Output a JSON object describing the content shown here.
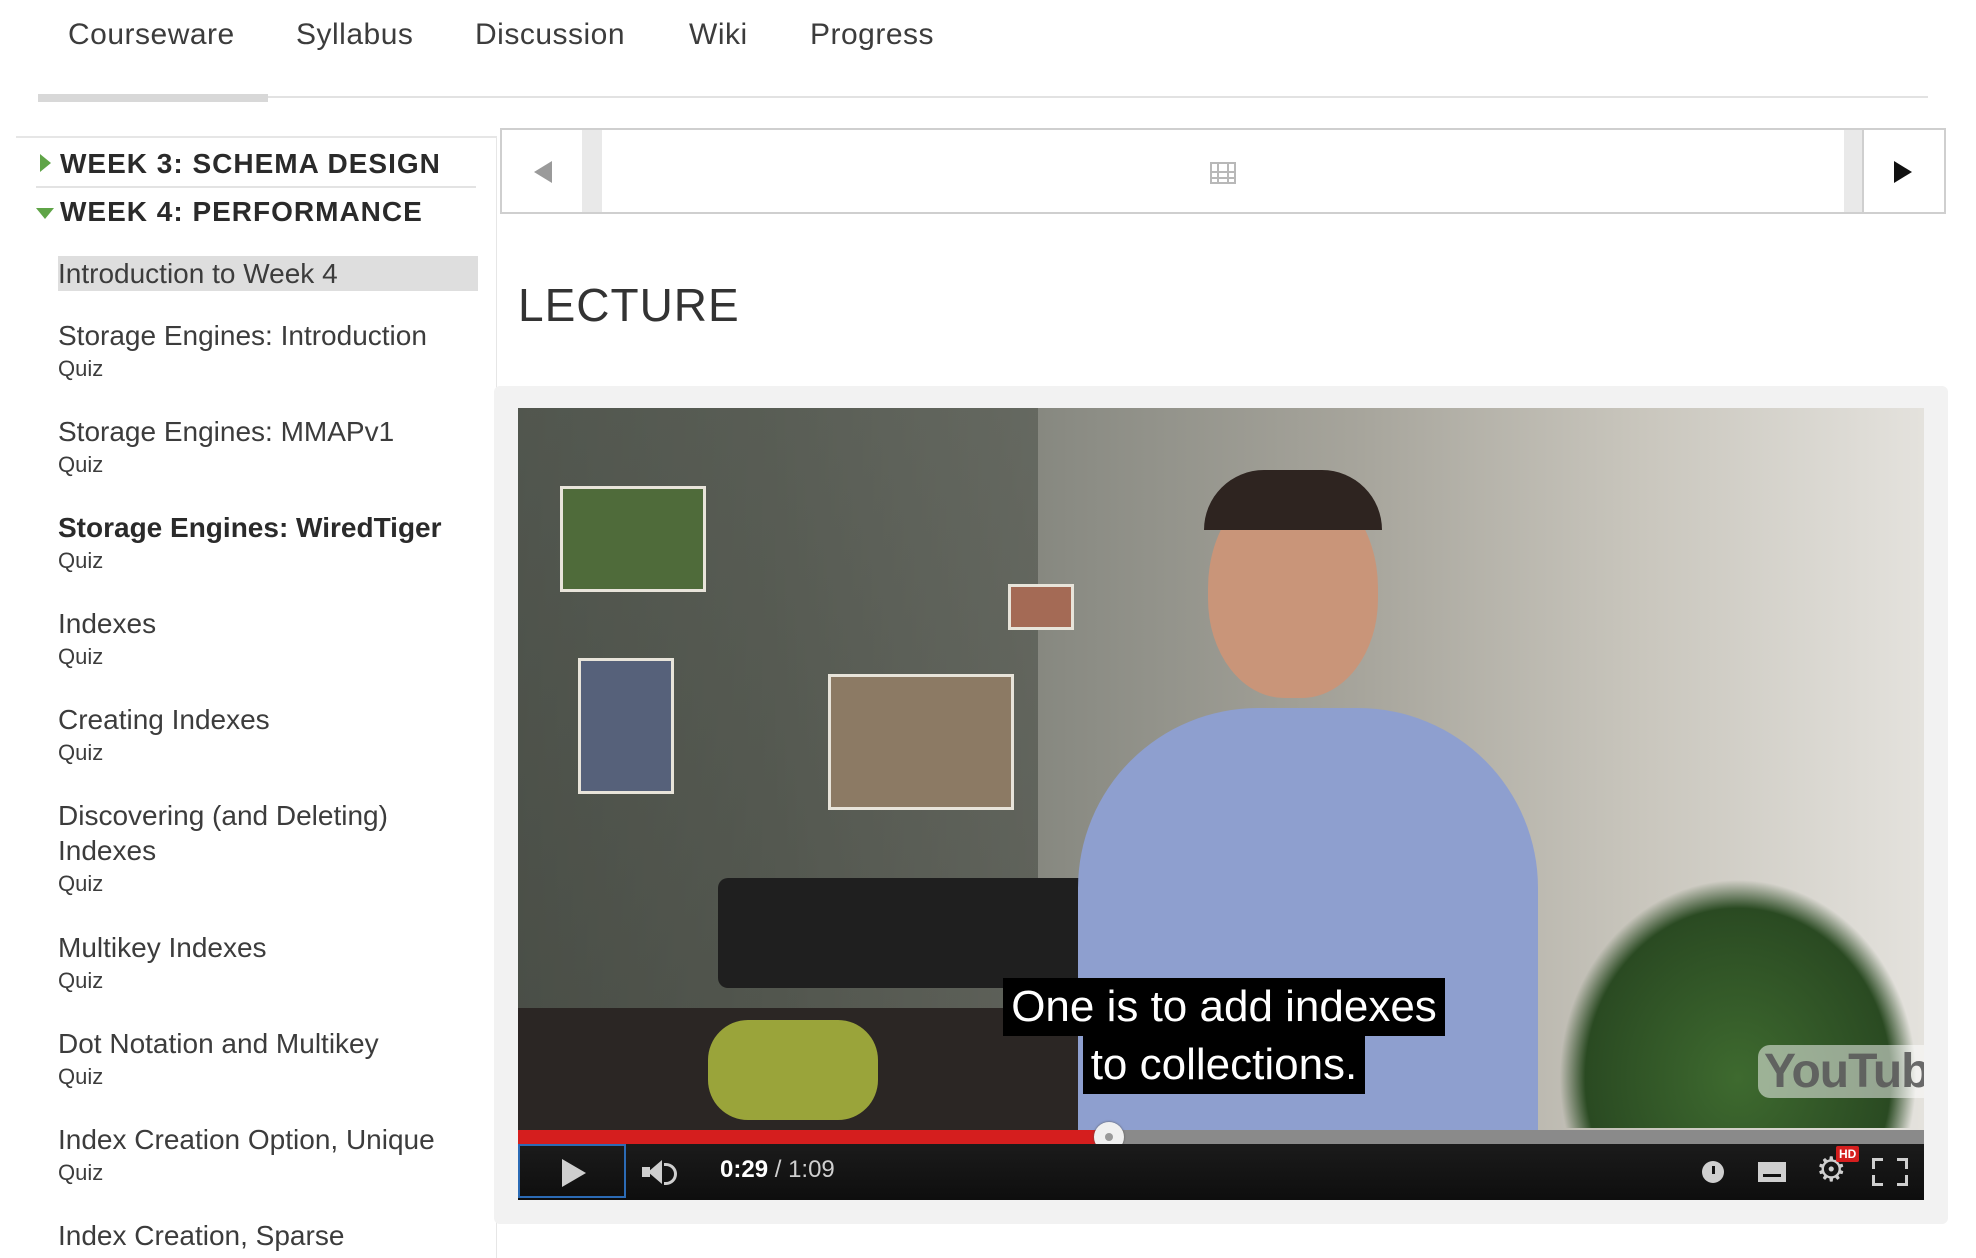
{
  "tabs": [
    {
      "label": "Courseware"
    },
    {
      "label": "Syllabus"
    },
    {
      "label": "Discussion"
    },
    {
      "label": "Wiki"
    },
    {
      "label": "Progress"
    }
  ],
  "sidebar": {
    "chapters": [
      {
        "label": "WEEK 3: SCHEMA DESIGN",
        "expanded": false
      },
      {
        "label": "WEEK 4: PERFORMANCE",
        "expanded": true
      }
    ],
    "items": [
      {
        "title": "Introduction to Week 4",
        "sub": ""
      },
      {
        "title": "Storage Engines: Introduction",
        "sub": "Quiz"
      },
      {
        "title": "Storage Engines: MMAPv1",
        "sub": "Quiz"
      },
      {
        "title": "Storage Engines: WiredTiger",
        "sub": "Quiz"
      },
      {
        "title": "Indexes",
        "sub": "Quiz"
      },
      {
        "title": "Creating Indexes",
        "sub": "Quiz"
      },
      {
        "title": "Discovering (and Deleting) Indexes",
        "sub": "Quiz"
      },
      {
        "title": "Multikey Indexes",
        "sub": "Quiz"
      },
      {
        "title": "Dot Notation and Multikey",
        "sub": "Quiz"
      },
      {
        "title": "Index Creation Option, Unique",
        "sub": "Quiz"
      },
      {
        "title": "Index Creation, Sparse",
        "sub": ""
      }
    ]
  },
  "main": {
    "section_title": "LECTURE"
  },
  "video": {
    "caption_line1": "One is to add indexes",
    "caption_line2": "to collections.",
    "logo": "YouTube",
    "current_time": "0:29",
    "separator": " / ",
    "duration": "1:09",
    "progress_fraction": 0.42,
    "hd_badge": "HD",
    "colors": {
      "played": "#d51e1e",
      "focus": "#2c6bb5"
    },
    "icons": [
      "play-icon",
      "volume-icon",
      "watch-later-icon",
      "captions-icon",
      "settings-gear-icon",
      "fullscreen-icon"
    ]
  }
}
